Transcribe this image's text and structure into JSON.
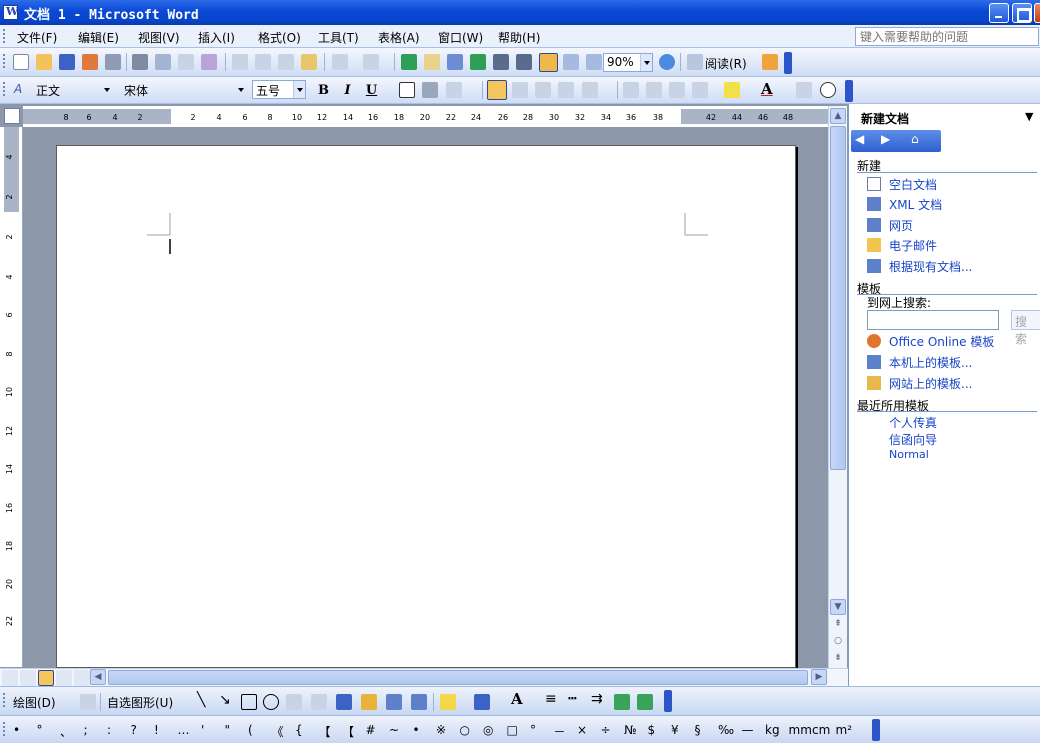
{
  "window": {
    "title": "文档 1 - Microsoft Word"
  },
  "menu": {
    "items": [
      "文件(F)",
      "编辑(E)",
      "视图(V)",
      "插入(I)",
      "格式(O)",
      "工具(T)",
      "表格(A)",
      "窗口(W)",
      "帮助(H)"
    ],
    "help_placeholder": "键入需要帮助的问题"
  },
  "standard_toolbar": {
    "zoom": "90%",
    "read_label": "阅读(R)"
  },
  "format_toolbar": {
    "style": "正文",
    "font": "宋体",
    "size": "五号",
    "bold": "B",
    "italic": "I",
    "underline": "U"
  },
  "ruler": {
    "h_ticks": [
      "8",
      "6",
      "4",
      "2",
      "2",
      "4",
      "6",
      "8",
      "10",
      "12",
      "14",
      "16",
      "18",
      "20",
      "22",
      "24",
      "26",
      "28",
      "30",
      "32",
      "34",
      "36",
      "38",
      "42",
      "44",
      "46",
      "48"
    ],
    "v_ticks": [
      "4",
      "2",
      "2",
      "4",
      "6",
      "8",
      "10",
      "12",
      "14",
      "16",
      "18",
      "20",
      "22"
    ]
  },
  "task_pane": {
    "title": "新建文档",
    "new_section": "新建",
    "new_items": [
      "空白文档",
      "XML 文档",
      "网页",
      "电子邮件",
      "根据现有文档..."
    ],
    "template_section": "模板",
    "search_label": "到网上搜索:",
    "search_button": "搜索",
    "template_items": [
      "Office Online 模板",
      "本机上的模板...",
      "网站上的模板..."
    ],
    "recent_section": "最近所用模板",
    "recent_items": [
      "个人传真",
      "信函向导",
      "Normal"
    ]
  },
  "drawing_toolbar": {
    "draw_label": "绘图(D)",
    "autoshape_label": "自选图形(U)"
  },
  "symbol_toolbar": {
    "symbols": [
      "•",
      "°",
      "、",
      ";",
      ":",
      "?",
      "!",
      "…",
      "'",
      "\"",
      "(",
      "《",
      "{",
      "【",
      "【",
      "#",
      "~",
      "•",
      "※",
      "○",
      "◎",
      "□",
      "°",
      "－",
      "×",
      "÷",
      "№",
      "$",
      "¥",
      "§",
      "‰",
      "—",
      "kg",
      "mm",
      "cm",
      "m²"
    ]
  },
  "colors": {
    "title_bar": "#0a49d6",
    "toolbar": "#d6e3f8",
    "task_link": "#1845c8"
  }
}
